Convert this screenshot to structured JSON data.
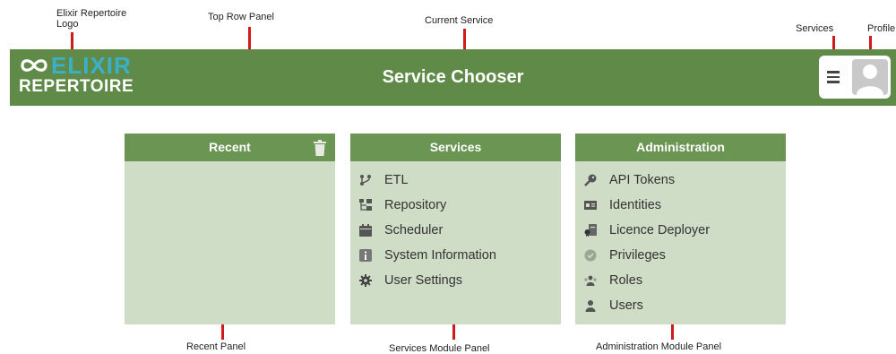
{
  "annotations": {
    "logo": "Elixir Repertoire\nLogo",
    "top_row": "Top Row Panel",
    "current_service": "Current Service",
    "services": "Services",
    "profile": "Profile",
    "recent_panel": "Recent Panel",
    "services_panel": "Services Module Panel",
    "admin_panel": "Administration Module Panel"
  },
  "header": {
    "logo_top": "ELIXIR",
    "logo_bottom": "REPERTOIRE",
    "title": "Service Chooser"
  },
  "panels": {
    "recent": {
      "title": "Recent"
    },
    "services": {
      "title": "Services",
      "items": [
        {
          "label": "ETL",
          "icon": "etl-icon"
        },
        {
          "label": "Repository",
          "icon": "repository-icon"
        },
        {
          "label": "Scheduler",
          "icon": "calendar-icon"
        },
        {
          "label": "System Information",
          "icon": "info-icon"
        },
        {
          "label": "User Settings",
          "icon": "gear-icon"
        }
      ]
    },
    "administration": {
      "title": "Administration",
      "items": [
        {
          "label": "API Tokens",
          "icon": "key-icon"
        },
        {
          "label": "Identities",
          "icon": "id-card-icon"
        },
        {
          "label": "Licence Deployer",
          "icon": "licence-icon"
        },
        {
          "label": "Privileges",
          "icon": "shield-icon"
        },
        {
          "label": "Roles",
          "icon": "group-icon"
        },
        {
          "label": "Users",
          "icon": "user-icon"
        }
      ]
    }
  },
  "colors": {
    "topbar": "#5f8a48",
    "panel_header": "#6a9553",
    "panel_body": "#cfdcc6",
    "logo_accent": "#3bb0c9",
    "callout_marker": "#d11a1a"
  }
}
